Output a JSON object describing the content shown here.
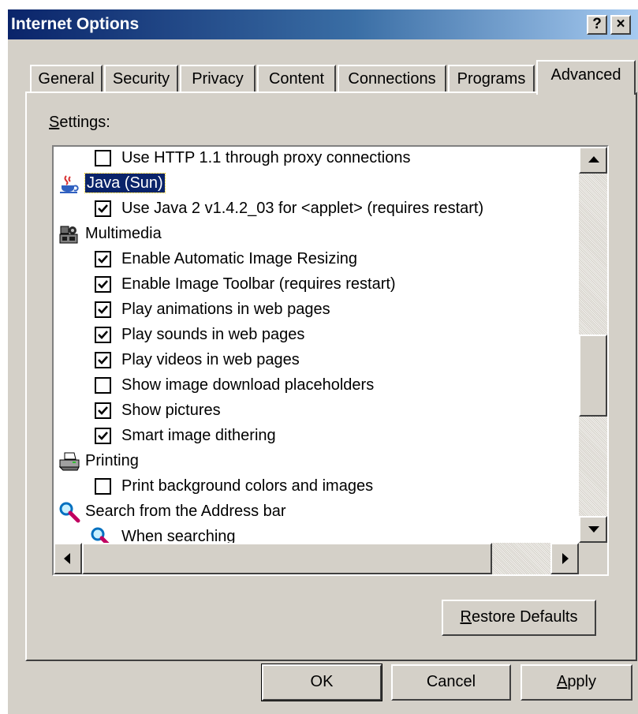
{
  "window": {
    "title": "Internet Options",
    "help_button": "?",
    "close_button": "×"
  },
  "tabs": [
    {
      "label": "General",
      "active": false
    },
    {
      "label": "Security",
      "active": false
    },
    {
      "label": "Privacy",
      "active": false
    },
    {
      "label": "Content",
      "active": false
    },
    {
      "label": "Connections",
      "active": false
    },
    {
      "label": "Programs",
      "active": false
    },
    {
      "label": "Advanced",
      "active": true
    }
  ],
  "settings": {
    "label_mnemonic": "S",
    "label_rest": "ettings:",
    "items": [
      {
        "type": "checkbox",
        "label": "Use HTTP 1.1 through proxy connections",
        "checked": false
      },
      {
        "type": "category",
        "label": "Java (Sun)",
        "icon": "java-cup-icon",
        "selected": true
      },
      {
        "type": "checkbox",
        "label": "Use Java 2 v1.4.2_03 for <applet> (requires restart)",
        "checked": true
      },
      {
        "type": "category",
        "label": "Multimedia",
        "icon": "multimedia-icon",
        "selected": false
      },
      {
        "type": "checkbox",
        "label": "Enable Automatic Image Resizing",
        "checked": true
      },
      {
        "type": "checkbox",
        "label": "Enable Image Toolbar (requires restart)",
        "checked": true
      },
      {
        "type": "checkbox",
        "label": "Play animations in web pages",
        "checked": true
      },
      {
        "type": "checkbox",
        "label": "Play sounds in web pages",
        "checked": true
      },
      {
        "type": "checkbox",
        "label": "Play videos in web pages",
        "checked": true
      },
      {
        "type": "checkbox",
        "label": "Show image download placeholders",
        "checked": false
      },
      {
        "type": "checkbox",
        "label": "Show pictures",
        "checked": true
      },
      {
        "type": "checkbox",
        "label": "Smart image dithering",
        "checked": true
      },
      {
        "type": "category",
        "label": "Printing",
        "icon": "printer-icon",
        "selected": false
      },
      {
        "type": "checkbox",
        "label": "Print background colors and images",
        "checked": false
      },
      {
        "type": "category",
        "label": "Search from the Address bar",
        "icon": "magnifier-icon",
        "selected": false
      },
      {
        "type": "subcategory",
        "label": "When searching",
        "icon": "magnifier-icon",
        "selected": false
      }
    ]
  },
  "buttons": {
    "restore_mnemonic": "R",
    "restore_rest": "estore Defaults",
    "ok": "OK",
    "cancel": "Cancel",
    "apply_mnemonic": "A",
    "apply_rest": "pply"
  },
  "colors": {
    "title_start": "#0a246a",
    "title_end": "#a6caf0",
    "face": "#d4d0c8",
    "selection": "#0a246a"
  }
}
